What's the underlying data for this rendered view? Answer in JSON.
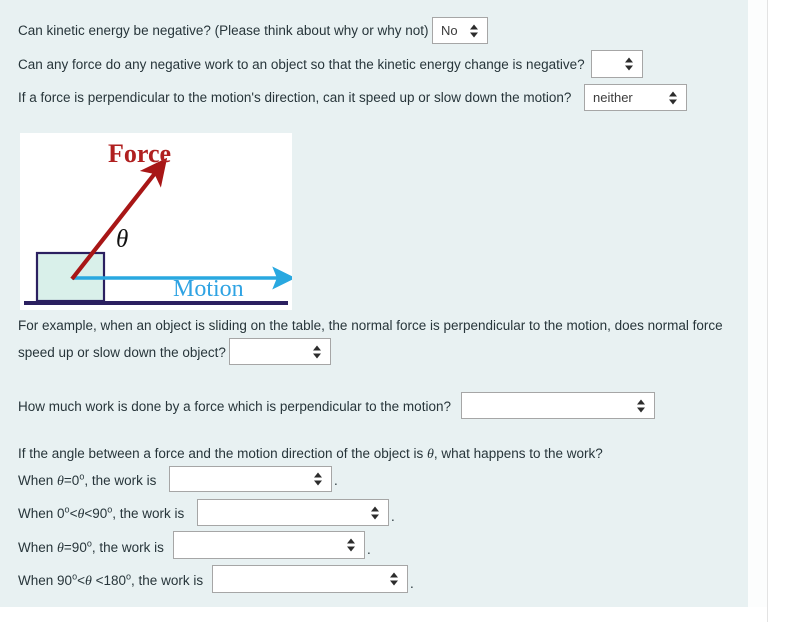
{
  "panel": {
    "background_color": "#e8f1f2",
    "text_color": "#27353a"
  },
  "questions": [
    {
      "id": "q1",
      "text": "Can kinetic energy be negative? (Please think about why or why not)",
      "select": {
        "value": "No",
        "placeholder": ""
      }
    },
    {
      "id": "q2",
      "text": "Can any force do any negative work to an object so that the kinetic energy change is negative?",
      "select": {
        "value": "",
        "placeholder": ""
      }
    },
    {
      "id": "q3",
      "text": "If a force is perpendicular to the motion's direction, can it speed up or slow down the motion?",
      "select": {
        "value": "neither",
        "placeholder": ""
      }
    }
  ],
  "figure": {
    "name": "force-motion-diagram",
    "force_label": "Force",
    "motion_label": "Motion",
    "angle_label": "θ",
    "colors": {
      "force_arrow": "#a81616",
      "motion_arrow": "#29a8e0",
      "block_fill": "#d9f0ea",
      "block_border": "#2b2060",
      "ground": "#2b2060",
      "force_text": "#b02020",
      "motion_text": "#2fa3e3"
    }
  },
  "example": {
    "line1": "For example, when an object is sliding on the table, the normal force is perpendicular to the motion, does normal force",
    "line2": "speed up or slow down the object?",
    "select": {
      "value": "",
      "placeholder": ""
    }
  },
  "work_question": {
    "text": "How much work is done by a force which is perpendicular to the motion?",
    "select": {
      "value": "",
      "placeholder": ""
    }
  },
  "angle_intro": {
    "prefix": "If the angle between a force and the motion direction of the object is ",
    "symbol": "θ",
    "suffix": ", what happens to the work?"
  },
  "angle_cases": [
    {
      "id": "case-theta-0",
      "lead_prefix": "When ",
      "condition_html": "<span class=\"ital\">θ</span>=0<sup>o</sup>",
      "lead_suffix": ", the work is",
      "plain": "When θ=0º, the work is",
      "select": {
        "value": "",
        "placeholder": ""
      },
      "trailing": "."
    },
    {
      "id": "case-theta-0-90",
      "lead_prefix": "When ",
      "condition_html": "0<sup>o</sup>&lt;<span class=\"ital\">θ</span>&lt;90<sup>o</sup>",
      "lead_suffix": ", the work is",
      "plain": "When 0º<θ<90º, the work is",
      "select": {
        "value": "",
        "placeholder": ""
      },
      "trailing": "."
    },
    {
      "id": "case-theta-90",
      "lead_prefix": "When ",
      "condition_html": "<span class=\"ital\">θ</span>=90<sup>o</sup>",
      "lead_suffix": ", the work is",
      "plain": "When θ=90º, the work is",
      "select": {
        "value": "",
        "placeholder": ""
      },
      "trailing": "."
    },
    {
      "id": "case-theta-90-180",
      "lead_prefix": "When ",
      "condition_html": "90<sup>o</sup>&lt;<span class=\"ital\">θ</span> &lt;180<sup>o</sup>",
      "lead_suffix": ", the work is",
      "plain": "When 90º<θ <180º, the work is",
      "select": {
        "value": "",
        "placeholder": ""
      },
      "trailing": "."
    }
  ]
}
